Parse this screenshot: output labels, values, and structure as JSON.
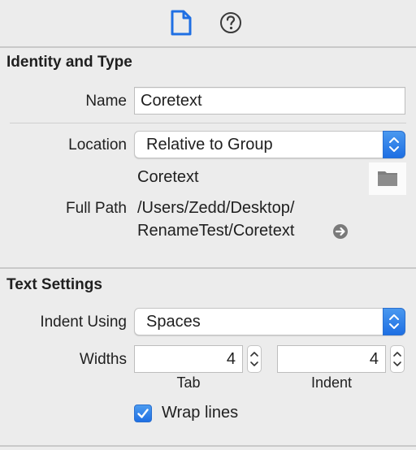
{
  "tabs": {
    "file_icon": "file-inspector-icon",
    "help_icon": "quick-help-icon",
    "accent": "#1f6fe3"
  },
  "identity": {
    "title": "Identity and Type",
    "name_label": "Name",
    "name_value": "Coretext",
    "location_label": "Location",
    "location_value": "Relative to Group",
    "location_filename": "Coretext",
    "fullpath_label": "Full Path",
    "fullpath_line1": "/Users/Zedd/Desktop/",
    "fullpath_line2": "RenameTest/Coretext"
  },
  "text_settings": {
    "title": "Text Settings",
    "indent_label": "Indent Using",
    "indent_value": "Spaces",
    "widths_label": "Widths",
    "tab_width": "4",
    "tab_label": "Tab",
    "indent_width": "4",
    "indent_sublabel": "Indent",
    "wrap_label": "Wrap lines",
    "wrap_checked": true
  }
}
